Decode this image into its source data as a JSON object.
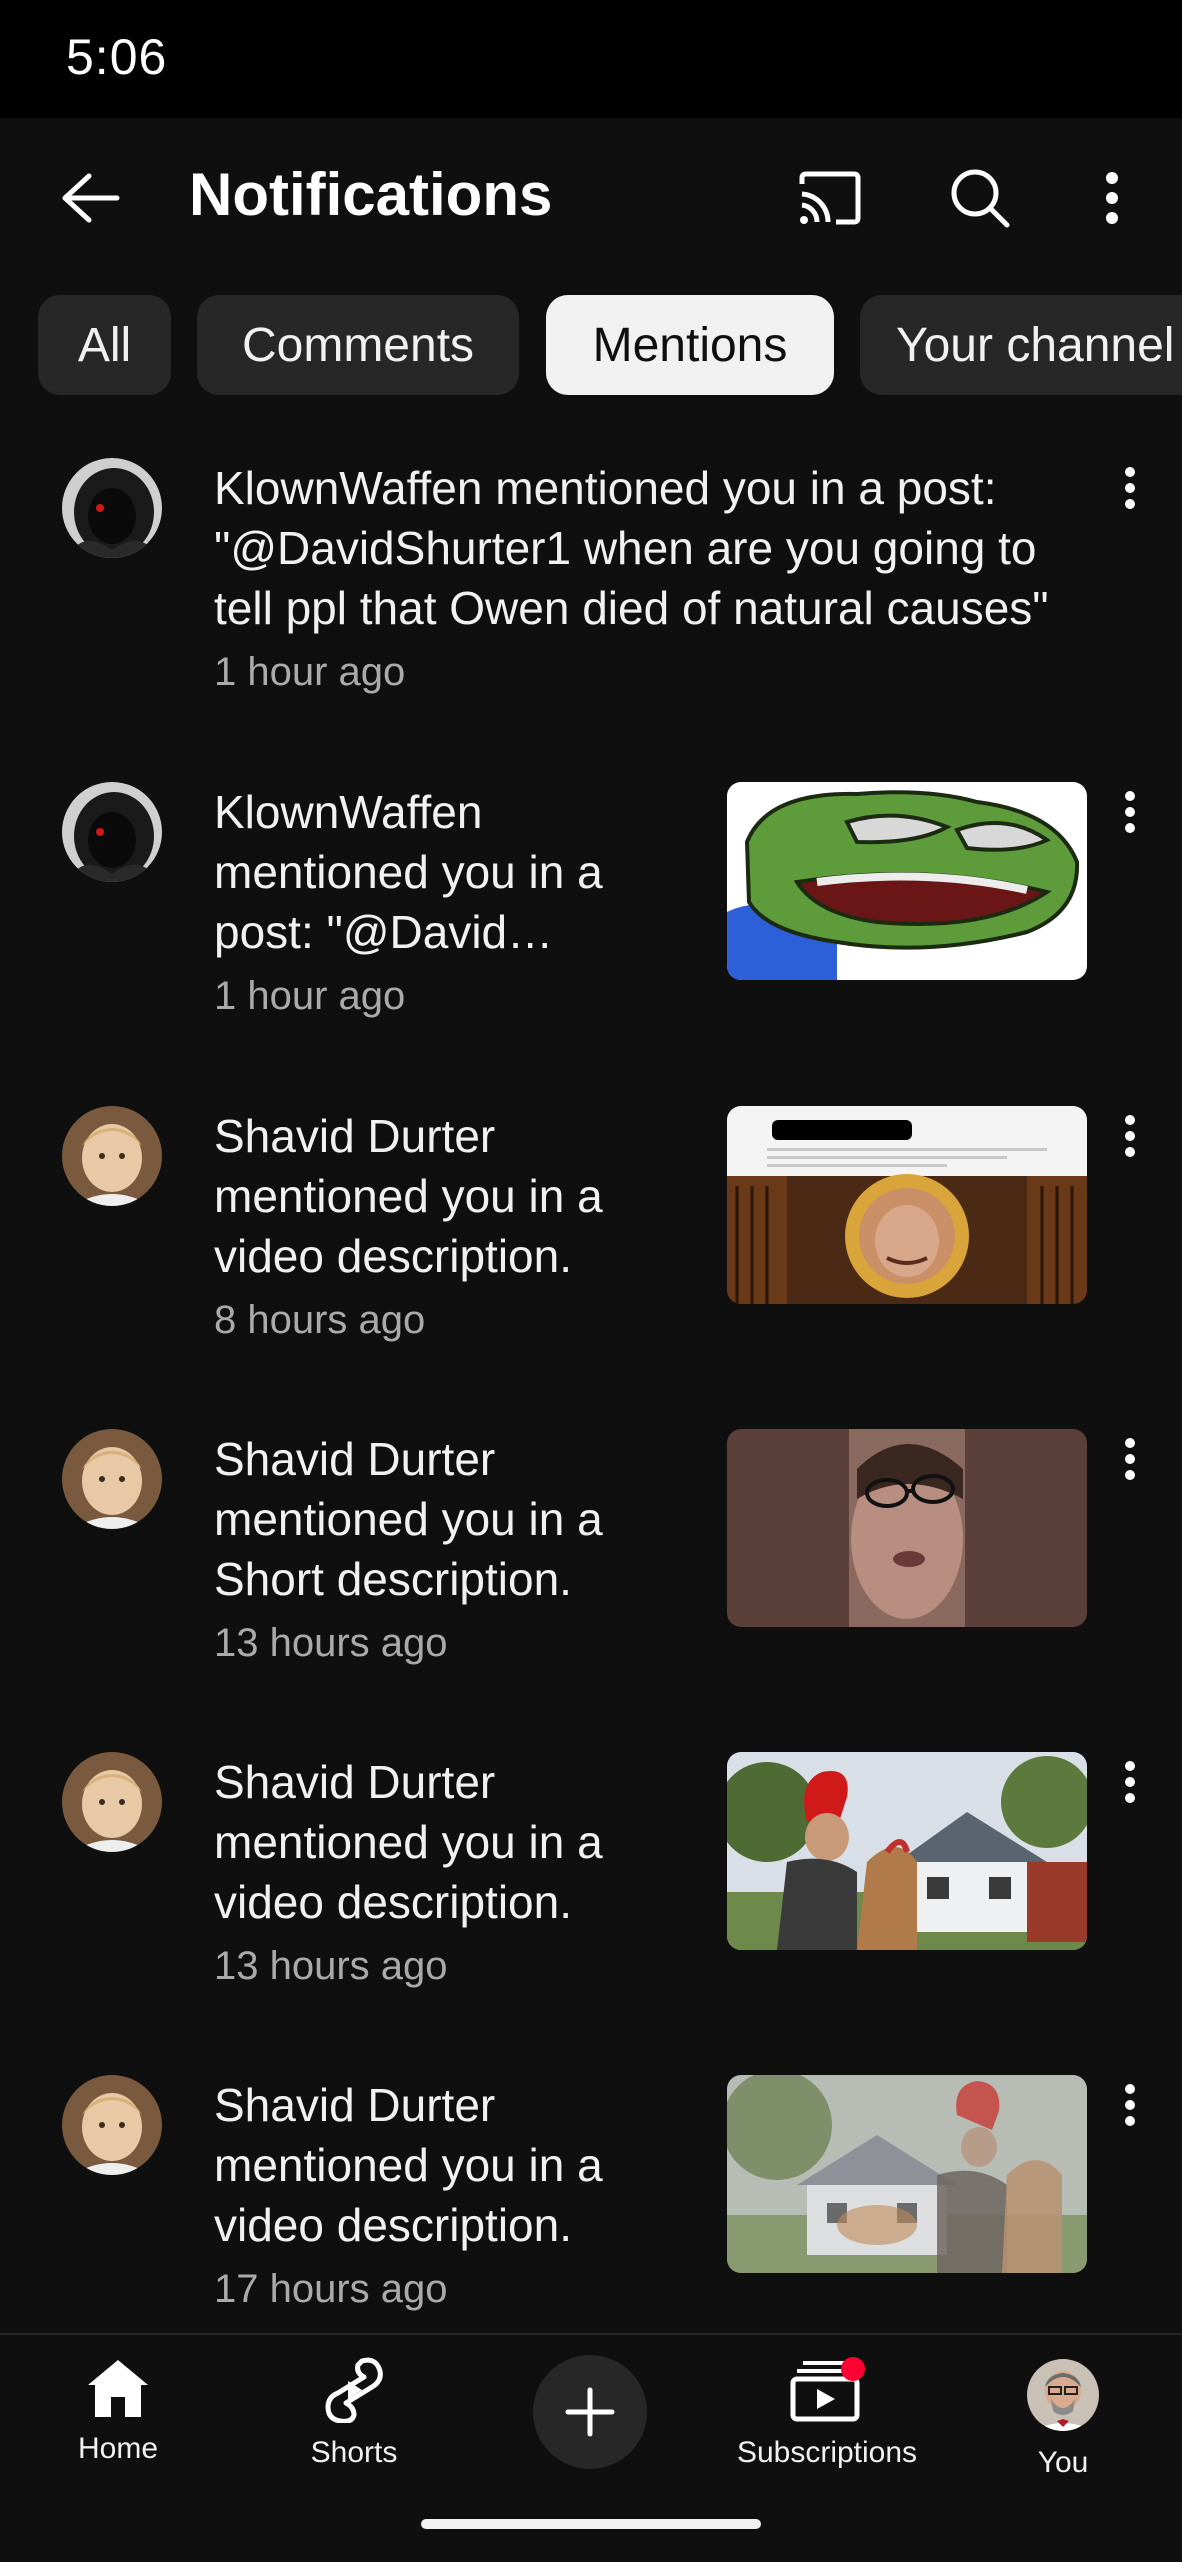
{
  "status_bar": {
    "time": "5:06"
  },
  "header": {
    "title": "Notifications"
  },
  "filters": [
    {
      "label": "All",
      "active": false
    },
    {
      "label": "Comments",
      "active": false
    },
    {
      "label": "Mentions",
      "active": true
    },
    {
      "label": "Your channel",
      "active": false
    }
  ],
  "notifications": [
    {
      "author_avatar": "hooded-figure-avatar",
      "message": "KlownWaffen mentioned you in a post: \"@DavidShurter1 when are you going to tell ppl that Owen died of natural causes\"",
      "time": "1 hour ago",
      "thumbnail": null
    },
    {
      "author_avatar": "hooded-figure-avatar",
      "message": "KlownWaffen mentioned you in a post: \"@David…",
      "time": "1 hour ago",
      "thumbnail": "cartoon-frog"
    },
    {
      "author_avatar": "child-photo-avatar",
      "message": "Shavid Durter mentioned you in a video description.",
      "time": "8 hours ago",
      "thumbnail": "library-collage"
    },
    {
      "author_avatar": "child-photo-avatar",
      "message": "Shavid Durter mentioned you in a Short description.",
      "time": "13 hours ago",
      "thumbnail": "face-closeup"
    },
    {
      "author_avatar": "child-photo-avatar",
      "message": "Shavid Durter mentioned you in a video description.",
      "time": "13 hours ago",
      "thumbnail": "house-camel"
    },
    {
      "author_avatar": "child-photo-avatar",
      "message": "Shavid Durter mentioned you in a video description.",
      "time": "17 hours ago",
      "thumbnail": "house-camel-faded"
    }
  ],
  "bottom_nav": {
    "home": "Home",
    "shorts": "Shorts",
    "subscriptions": "Subscriptions",
    "you": "You"
  },
  "colors": {
    "background": "#0f0f0f",
    "chip": "#272727",
    "chip_active": "#f1f1f1",
    "badge": "#ff0033"
  }
}
